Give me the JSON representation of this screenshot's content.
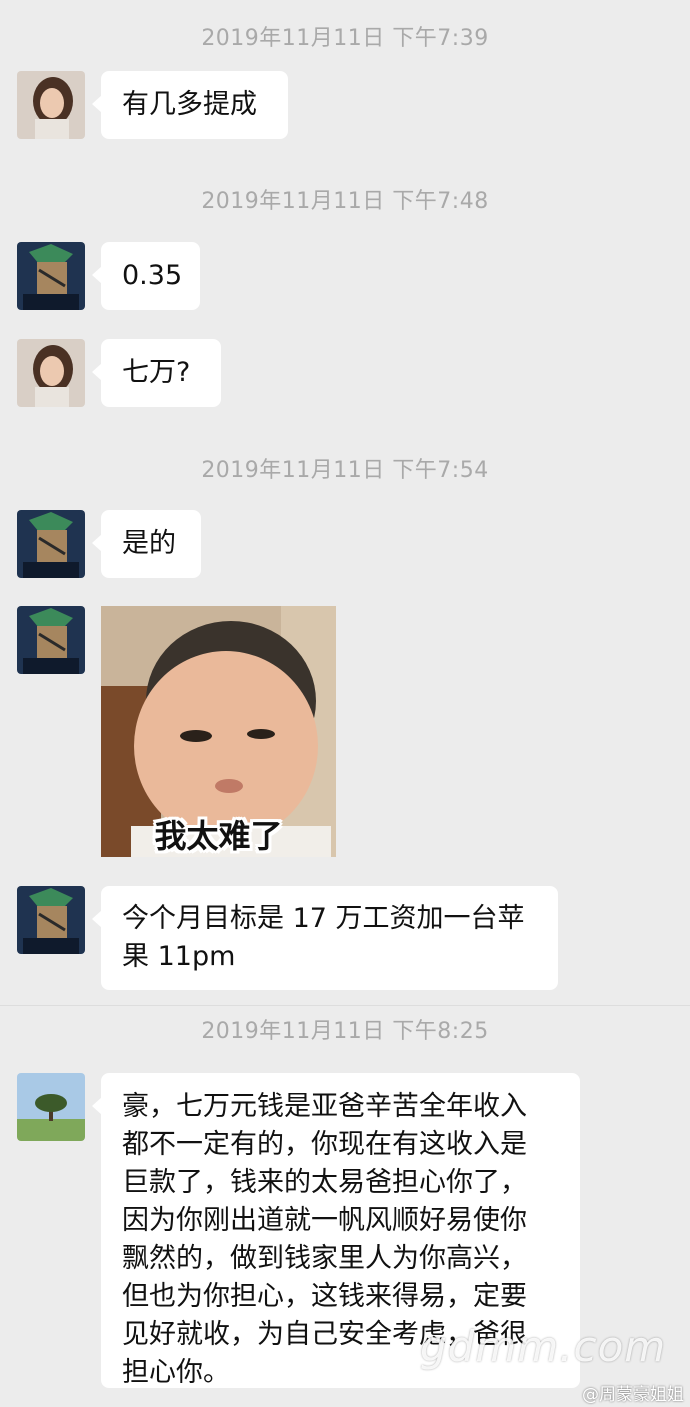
{
  "timestamps": [
    "2019年11月11日 下午7:39",
    "2019年11月11日 下午7:48",
    "2019年11月11日 下午7:54",
    "2019年11月11日 下午8:25"
  ],
  "messages": [
    {
      "sender": "girl",
      "text": "有几多提成"
    },
    {
      "sender": "zoro",
      "text": "0.35"
    },
    {
      "sender": "girl",
      "text": "七万?"
    },
    {
      "sender": "zoro",
      "text": "是的"
    },
    {
      "sender": "zoro",
      "type": "sticker",
      "sticker_caption": "我太难了"
    },
    {
      "sender": "zoro",
      "text_lines": [
        "今个月目标是 17 万工资加一台苹",
        "果 11pm"
      ]
    },
    {
      "sender": "tree",
      "text_lines": [
        "豪，七万元钱是亚爸辛苦全年收入",
        "都不一定有的，你现在有这收入是",
        "巨款了，钱来的太易爸担心你了，",
        "因为你刚出道就一帆风顺好易使你",
        "飘然的，做到钱家里人为你高兴，",
        "但也为你担心，这钱来得易，定要",
        "见好就收，为自己安全考虑，爸很",
        "担心你。"
      ]
    }
  ],
  "watermark": "gdmm.com",
  "weibo_credit": "@周蒙豪姐姐",
  "colors": {
    "background": "#ececec",
    "bubble": "#ffffff",
    "timestamp": "#a9a9a9"
  }
}
